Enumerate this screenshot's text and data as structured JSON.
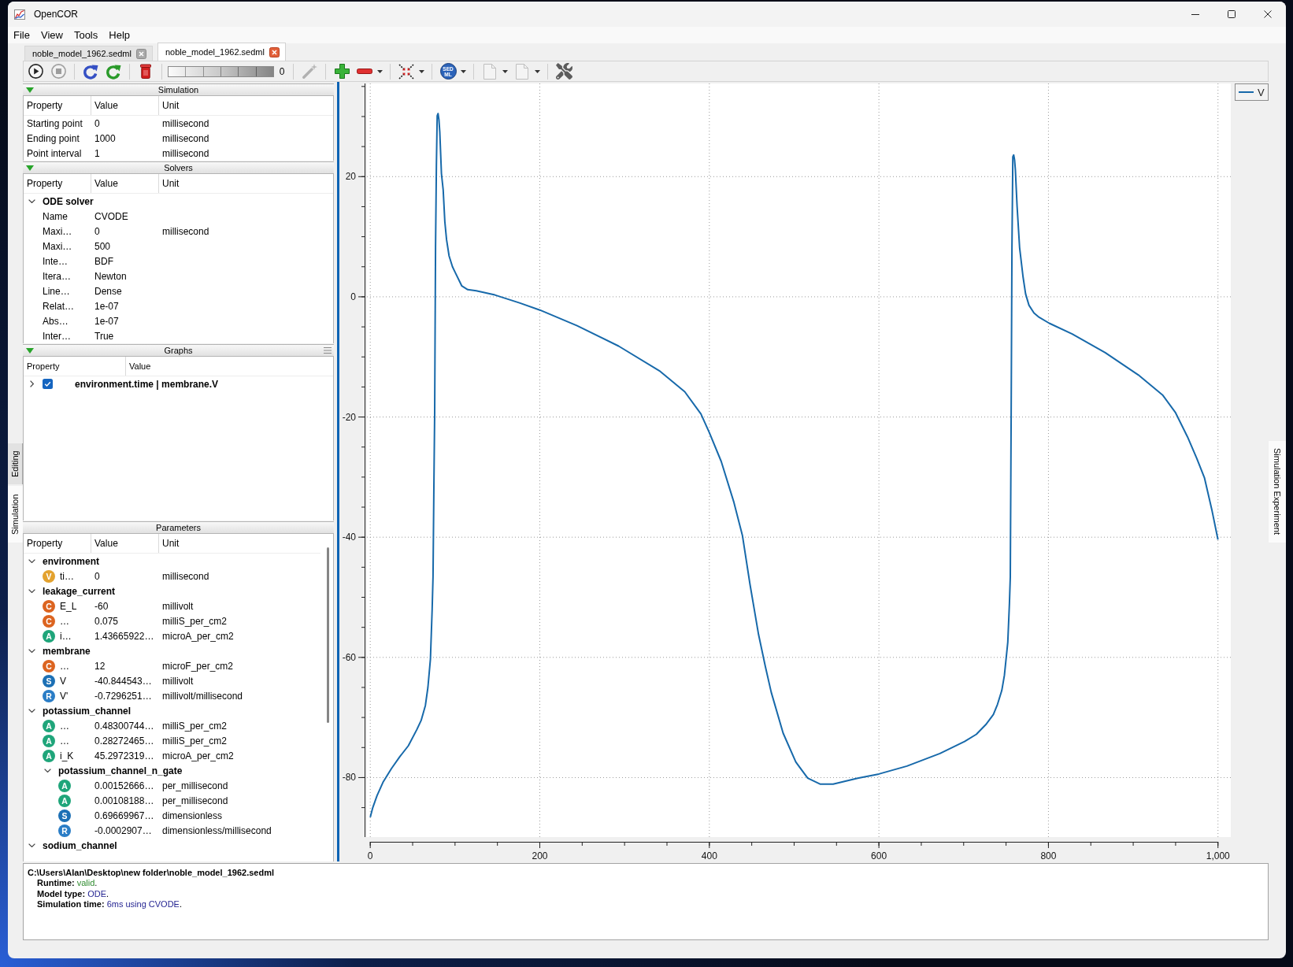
{
  "window": {
    "title": "OpenCOR"
  },
  "menu": [
    "File",
    "View",
    "Tools",
    "Help"
  ],
  "tabs": [
    {
      "label": "noble_model_1962.sedml",
      "selected": false
    },
    {
      "label": "noble_model_1962.sedml",
      "selected": true
    }
  ],
  "toolbar": [
    {
      "kind": "play",
      "disabled": false,
      "menu": false
    },
    {
      "kind": "stop",
      "disabled": true,
      "menu": false
    },
    {
      "kind": "separator"
    },
    {
      "kind": "reset",
      "disabled": false,
      "menu": false
    },
    {
      "kind": "rerun",
      "disabled": false,
      "menu": false
    },
    {
      "kind": "separator"
    },
    {
      "kind": "trash",
      "disabled": false,
      "menu": false
    },
    {
      "kind": "separator"
    },
    {
      "kind": "wheel",
      "disabled": false,
      "value": "0"
    },
    {
      "kind": "separator"
    },
    {
      "kind": "wand",
      "disabled": true,
      "menu": false
    },
    {
      "kind": "separator"
    },
    {
      "kind": "plus",
      "disabled": false,
      "menu": false
    },
    {
      "kind": "minus",
      "disabled": false,
      "menu": true
    },
    {
      "kind": "separator"
    },
    {
      "kind": "arrows",
      "disabled": false,
      "menu": true
    },
    {
      "kind": "separator"
    },
    {
      "kind": "sedml",
      "disabled": false,
      "menu": true,
      "lines": [
        "SED",
        "ML"
      ]
    },
    {
      "kind": "separator"
    },
    {
      "kind": "document",
      "disabled": true,
      "menu": true
    },
    {
      "kind": "document",
      "disabled": true,
      "menu": true
    },
    {
      "kind": "separator"
    },
    {
      "kind": "tools",
      "disabled": false,
      "menu": false
    }
  ],
  "left_tabs": [
    {
      "label": "Editing",
      "selected": false
    },
    {
      "label": "Simulation",
      "selected": true
    }
  ],
  "right_tabs": [
    {
      "label": "Simulation Experiment",
      "selected": true
    }
  ],
  "simulation": {
    "title": "Simulation",
    "expanded": true,
    "columns": [
      "Property",
      "Value",
      "Unit"
    ],
    "rows": [
      {
        "property": "Starting point",
        "value": "0",
        "unit": "millisecond"
      },
      {
        "property": "Ending point",
        "value": "1000",
        "unit": "millisecond"
      },
      {
        "property": "Point interval",
        "value": "1",
        "unit": "millisecond"
      }
    ]
  },
  "solvers": {
    "title": "Solvers",
    "expanded": true,
    "columns": [
      "Property",
      "Value",
      "Unit"
    ],
    "tree": [
      {
        "name": "ODE solver",
        "expanded": true,
        "children": [
          {
            "name": "Name",
            "value": "CVODE"
          },
          {
            "name": "Maxi…",
            "value": "0",
            "unit": "millisecond"
          },
          {
            "name": "Maxi…",
            "value": "500"
          },
          {
            "name": "Inte…",
            "value": "BDF"
          },
          {
            "name": "Itera…",
            "value": "Newton"
          },
          {
            "name": "Line…",
            "value": "Dense"
          },
          {
            "name": "Relat…",
            "value": "1e-07"
          },
          {
            "name": "Abs…",
            "value": "1e-07"
          },
          {
            "name": "Inter…",
            "value": "True"
          }
        ]
      }
    ]
  },
  "graphs": {
    "title": "Graphs",
    "expanded": true,
    "columns": [
      "Property",
      "Value"
    ],
    "rows": [
      {
        "label": "environment.time | membrane.V",
        "expanded": false,
        "checked": true
      }
    ]
  },
  "parameters": {
    "title": "Parameters",
    "columns": [
      "Property",
      "Value",
      "Unit"
    ],
    "tree": [
      {
        "name": "environment",
        "expanded": true,
        "children": [
          {
            "badge": "V",
            "color": "#e3a22f",
            "name": "ti…",
            "value": "0",
            "unit": "millisecond"
          }
        ]
      },
      {
        "name": "leakage_current",
        "expanded": true,
        "children": [
          {
            "badge": "C",
            "color": "#dc6420",
            "name": "E_L",
            "value": "-60",
            "unit": "millivolt"
          },
          {
            "badge": "C",
            "color": "#dc6420",
            "name": "…",
            "value": "0.075",
            "unit": "milliS_per_cm2"
          },
          {
            "badge": "A",
            "color": "#1fa57a",
            "name": "i…",
            "value": "1.43665922…",
            "unit": "microA_per_cm2"
          }
        ]
      },
      {
        "name": "membrane",
        "expanded": true,
        "children": [
          {
            "badge": "C",
            "color": "#dc6420",
            "name": "…",
            "value": "12",
            "unit": "microF_per_cm2"
          },
          {
            "badge": "S",
            "color": "#1c70b5",
            "name": "V",
            "value": "-40.844543…",
            "unit": "millivolt"
          },
          {
            "badge": "R",
            "color": "#2a7dc6",
            "name": "V'",
            "value": "-0.7296251…",
            "unit": "millivolt/millisecond"
          }
        ]
      },
      {
        "name": "potassium_channel",
        "expanded": true,
        "children": [
          {
            "badge": "A",
            "color": "#1fa57a",
            "name": "…",
            "value": "0.48300744…",
            "unit": "milliS_per_cm2"
          },
          {
            "badge": "A",
            "color": "#1fa57a",
            "name": "…",
            "value": "0.28272465…",
            "unit": "milliS_per_cm2"
          },
          {
            "badge": "A",
            "color": "#1fa57a",
            "name": "i_K",
            "value": "45.2972319…",
            "unit": "microA_per_cm2"
          },
          {
            "name": "potassium_channel_n_gate",
            "expanded": true,
            "children": [
              {
                "badge": "A",
                "color": "#1fa57a",
                "value": "0.00152666…",
                "unit": "per_millisecond"
              },
              {
                "badge": "A",
                "color": "#1fa57a",
                "value": "0.00108188…",
                "unit": "per_millisecond"
              },
              {
                "badge": "S",
                "color": "#1c70b5",
                "value": "0.69669967…",
                "unit": "dimensionless"
              },
              {
                "badge": "R",
                "color": "#2a7dc6",
                "value": "-0.0002907…",
                "unit": "dimensionless/millisecond"
              }
            ]
          }
        ]
      },
      {
        "name": "sodium_channel",
        "expanded": true
      }
    ]
  },
  "graph_panel": {
    "selected": true,
    "chart_data": {
      "type": "line",
      "grid": true,
      "x": [
        0,
        3,
        8,
        15,
        25,
        35,
        45,
        55,
        60,
        65,
        68,
        71,
        73,
        74,
        75,
        76,
        77,
        78,
        79,
        80,
        81,
        82,
        84,
        86,
        88,
        90,
        93,
        97,
        100,
        108,
        115,
        125,
        147,
        176,
        200,
        244,
        293,
        341,
        371,
        390,
        400,
        414,
        429,
        439,
        448,
        458,
        466,
        473,
        487,
        502,
        516,
        531,
        546,
        575,
        600,
        633,
        672,
        701,
        715,
        726,
        735,
        740,
        745,
        748,
        752,
        754,
        755,
        756,
        757,
        758,
        759,
        760,
        761,
        763,
        766,
        770,
        773,
        777,
        783,
        789,
        801,
        828,
        867,
        906,
        935,
        950,
        964,
        975,
        984,
        993,
        1000
      ],
      "series": [
        {
          "name": "V",
          "color": "#1769aa",
          "values": [
            -86.6,
            -85,
            -83,
            -80.8,
            -78.5,
            -76.5,
            -74.7,
            -72,
            -70.5,
            -68,
            -65,
            -60.3,
            -52,
            -46.6,
            -33,
            -19.2,
            8.2,
            22,
            30.1,
            30.5,
            29.5,
            27.4,
            20.5,
            17.8,
            12.5,
            9.5,
            6.8,
            5,
            4.1,
            1.8,
            1.2,
            1,
            0.3,
            -1,
            -2.2,
            -4.8,
            -8.2,
            -12.3,
            -15.8,
            -19.5,
            -22.6,
            -27.4,
            -34.2,
            -39.7,
            -47.9,
            -56.2,
            -61.5,
            -65.8,
            -72.6,
            -77.4,
            -80.1,
            -81.1,
            -81.1,
            -80.1,
            -79.4,
            -78.1,
            -76,
            -74,
            -72.8,
            -71.2,
            -69.5,
            -67.8,
            -65.5,
            -63,
            -57.5,
            -51,
            -46.6,
            -19.2,
            8.2,
            23.3,
            23.6,
            22.8,
            21.2,
            15.1,
            8.2,
            3.4,
            0.5,
            -1.4,
            -2.7,
            -3.4,
            -4.4,
            -6.2,
            -9.3,
            -13,
            -16.4,
            -19.3,
            -23.3,
            -26.9,
            -30.1,
            -35.6,
            -40.4
          ]
        }
      ],
      "xlim": [
        -3.9,
        1015.1
      ],
      "ylim": [
        -89.9,
        35.5
      ],
      "xticks": [
        0,
        200,
        400,
        600,
        800,
        {
          "value": 1000,
          "label": "1,000"
        }
      ],
      "yticks": [
        -80,
        -60,
        -40,
        -20,
        0,
        20
      ]
    }
  },
  "output": {
    "path": "C:\\Users\\Alan\\Desktop\\new folder\\noble_model_1962.sedml",
    "lines": [
      {
        "label": "Runtime:",
        "value": "valid",
        "suffix": ".",
        "color": "#2e8b2e"
      },
      {
        "label": "Model type:",
        "value": "ODE",
        "suffix": ".",
        "color": "#1f1f8f"
      },
      {
        "label": "Simulation time:",
        "value": "6ms using CVODE",
        "suffix": ".",
        "color": "#1f1f8f"
      }
    ]
  }
}
